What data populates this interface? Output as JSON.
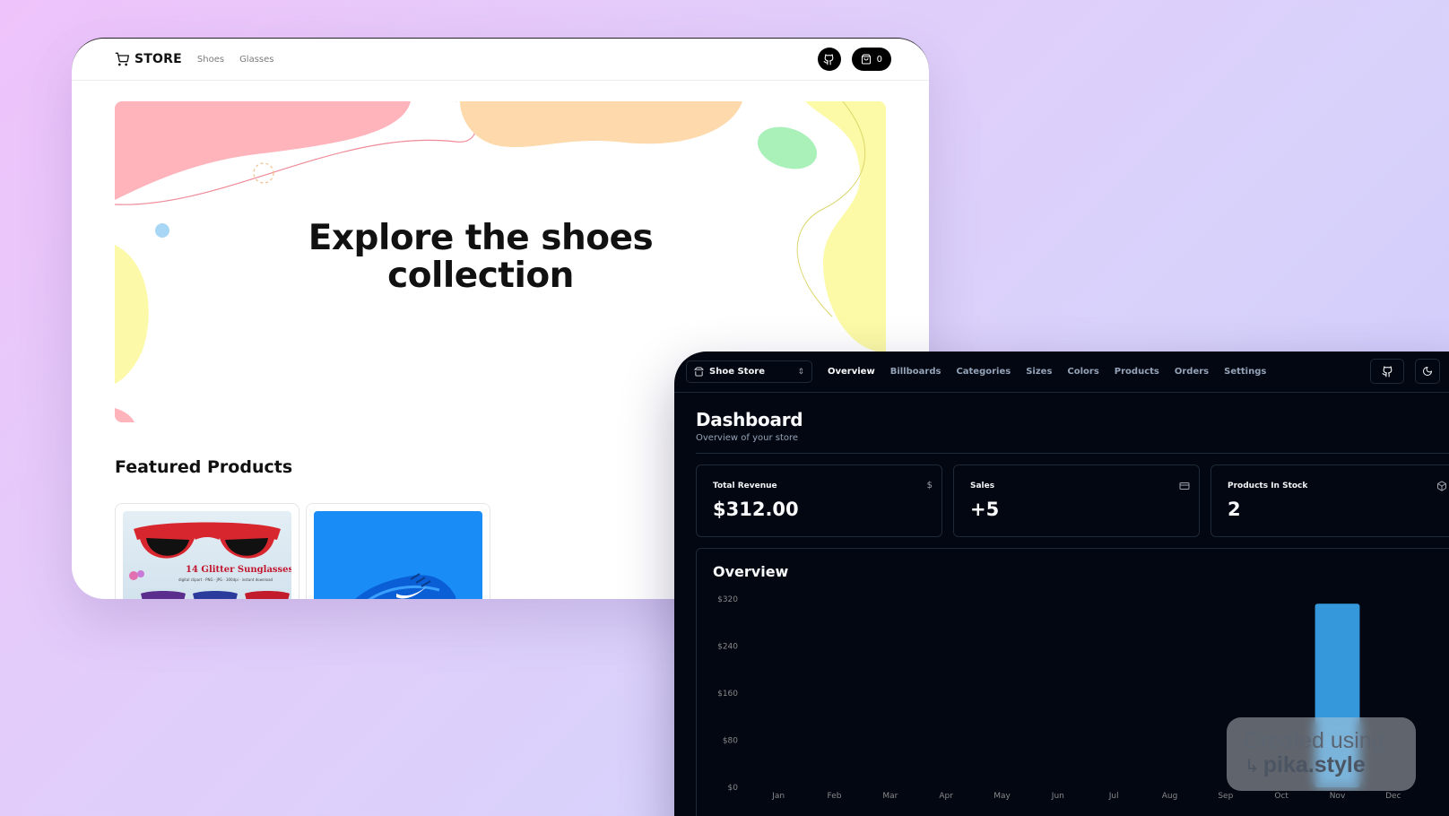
{
  "store": {
    "brand": "STORE",
    "nav": [
      "Shoes",
      "Glasses"
    ],
    "cart_count": "0",
    "hero_title_line1": "Explore the shoes",
    "hero_title_line2": "collection",
    "featured_title": "Featured Products",
    "products": [
      {
        "caption": "14 Glitter Sunglasses",
        "subcaption": "digital clipart · PNG · JPG · 300dpi · instant download",
        "icon": "sunglasses-image"
      },
      {
        "icon": "sneaker-image"
      }
    ]
  },
  "dashboard": {
    "store_switcher": "Shoe Store",
    "nav": [
      "Overview",
      "Billboards",
      "Categories",
      "Sizes",
      "Colors",
      "Products",
      "Orders",
      "Settings"
    ],
    "active_nav": "Overview",
    "title": "Dashboard",
    "subtitle": "Overview of your store",
    "stats": [
      {
        "label": "Total Revenue",
        "value": "$312.00",
        "icon": "dollar-icon"
      },
      {
        "label": "Sales",
        "value": "+5",
        "icon": "credit-card-icon"
      },
      {
        "label": "Products In Stock",
        "value": "2",
        "icon": "package-icon"
      }
    ],
    "overview_title": "Overview"
  },
  "chart_data": {
    "type": "bar",
    "categories": [
      "Jan",
      "Feb",
      "Mar",
      "Apr",
      "May",
      "Jun",
      "Jul",
      "Aug",
      "Sep",
      "Oct",
      "Nov",
      "Dec"
    ],
    "values": [
      0,
      0,
      0,
      0,
      0,
      0,
      0,
      0,
      0,
      0,
      312,
      0
    ],
    "ytick_labels": [
      "$0",
      "$80",
      "$160",
      "$240",
      "$320"
    ],
    "yticks": [
      0,
      80,
      160,
      240,
      320
    ],
    "ylim": [
      0,
      320
    ],
    "grid": false,
    "bar_color": "#3498db"
  },
  "watermark": {
    "line1": "Created using",
    "line2": "pika.style",
    "arrow": "↳"
  },
  "colors": {
    "dash_bg": "#030712",
    "dash_border": "#1f2937",
    "muted_text": "#94a3b8"
  }
}
